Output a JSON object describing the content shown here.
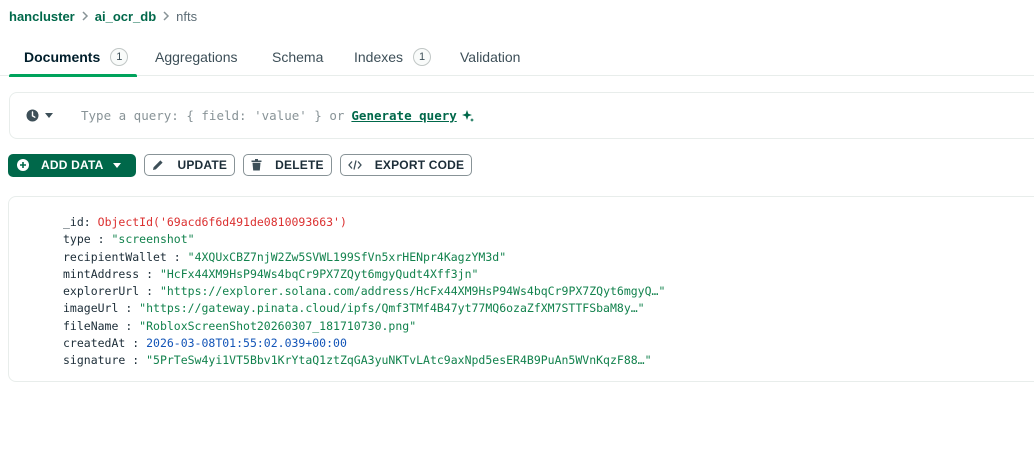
{
  "breadcrumb": {
    "cluster": "hancluster",
    "database": "ai_ocr_db",
    "collection": "nfts"
  },
  "tabs": [
    {
      "label": "Documents",
      "badge": "1",
      "active": true
    },
    {
      "label": "Aggregations",
      "badge": "",
      "active": false
    },
    {
      "label": "Schema",
      "badge": "",
      "active": false
    },
    {
      "label": "Indexes",
      "badge": "1",
      "active": false
    },
    {
      "label": "Validation",
      "badge": "",
      "active": false
    }
  ],
  "query_bar": {
    "placeholder": "Type a query: { field: 'value' } or",
    "generate_link": "Generate query"
  },
  "toolbar": {
    "add_data": "ADD DATA",
    "update": "UPDATE",
    "delete": "DELETE",
    "export_code": "EXPORT CODE"
  },
  "document": {
    "fields": [
      {
        "key": "_id",
        "value": "ObjectId('69acd6f6d491de0810093663')",
        "kind": "oid"
      },
      {
        "key": "type",
        "value": "\"screenshot\"",
        "kind": "str"
      },
      {
        "key": "recipientWallet",
        "value": "\"4XQUxCBZ7njW2Zw5SVWL199SfVn5xrHENpr4KagzYM3d\"",
        "kind": "str"
      },
      {
        "key": "mintAddress",
        "value": "\"HcFx44XM9HsP94Ws4bqCr9PX7ZQyt6mgyQudt4Xff3jn\"",
        "kind": "str"
      },
      {
        "key": "explorerUrl",
        "value": "\"https://explorer.solana.com/address/HcFx44XM9HsP94Ws4bqCr9PX7ZQyt6mgyQ…\"",
        "kind": "str"
      },
      {
        "key": "imageUrl",
        "value": "\"https://gateway.pinata.cloud/ipfs/Qmf3TMf4B47yt77MQ6ozaZfXM7STTFSbaM8y…\"",
        "kind": "str"
      },
      {
        "key": "fileName",
        "value": "\"RobloxScreenShot20260307_181710730.png\"",
        "kind": "str"
      },
      {
        "key": "createdAt",
        "value": "2026-03-08T01:55:02.039+00:00",
        "kind": "date"
      },
      {
        "key": "signature",
        "value": "\"5PrTeSw4yi1VT5Bbv1KrYtaQ1ztZqGA3yuNKTvLAtc9axNpd5esER4B9PuAn5WVnKqzF88…\"",
        "kind": "str"
      }
    ]
  },
  "colors": {
    "brand_green": "#00684a",
    "tab_underline": "#00a35c",
    "string_value": "#12824d",
    "objectid_value": "#db3030",
    "date_value": "#1254b7"
  },
  "icons": {
    "history": "clock-icon",
    "sparkle": "sparkle-icon",
    "add": "plus-circle-icon",
    "update": "pencil-icon",
    "delete": "trash-icon",
    "export": "code-icon"
  }
}
